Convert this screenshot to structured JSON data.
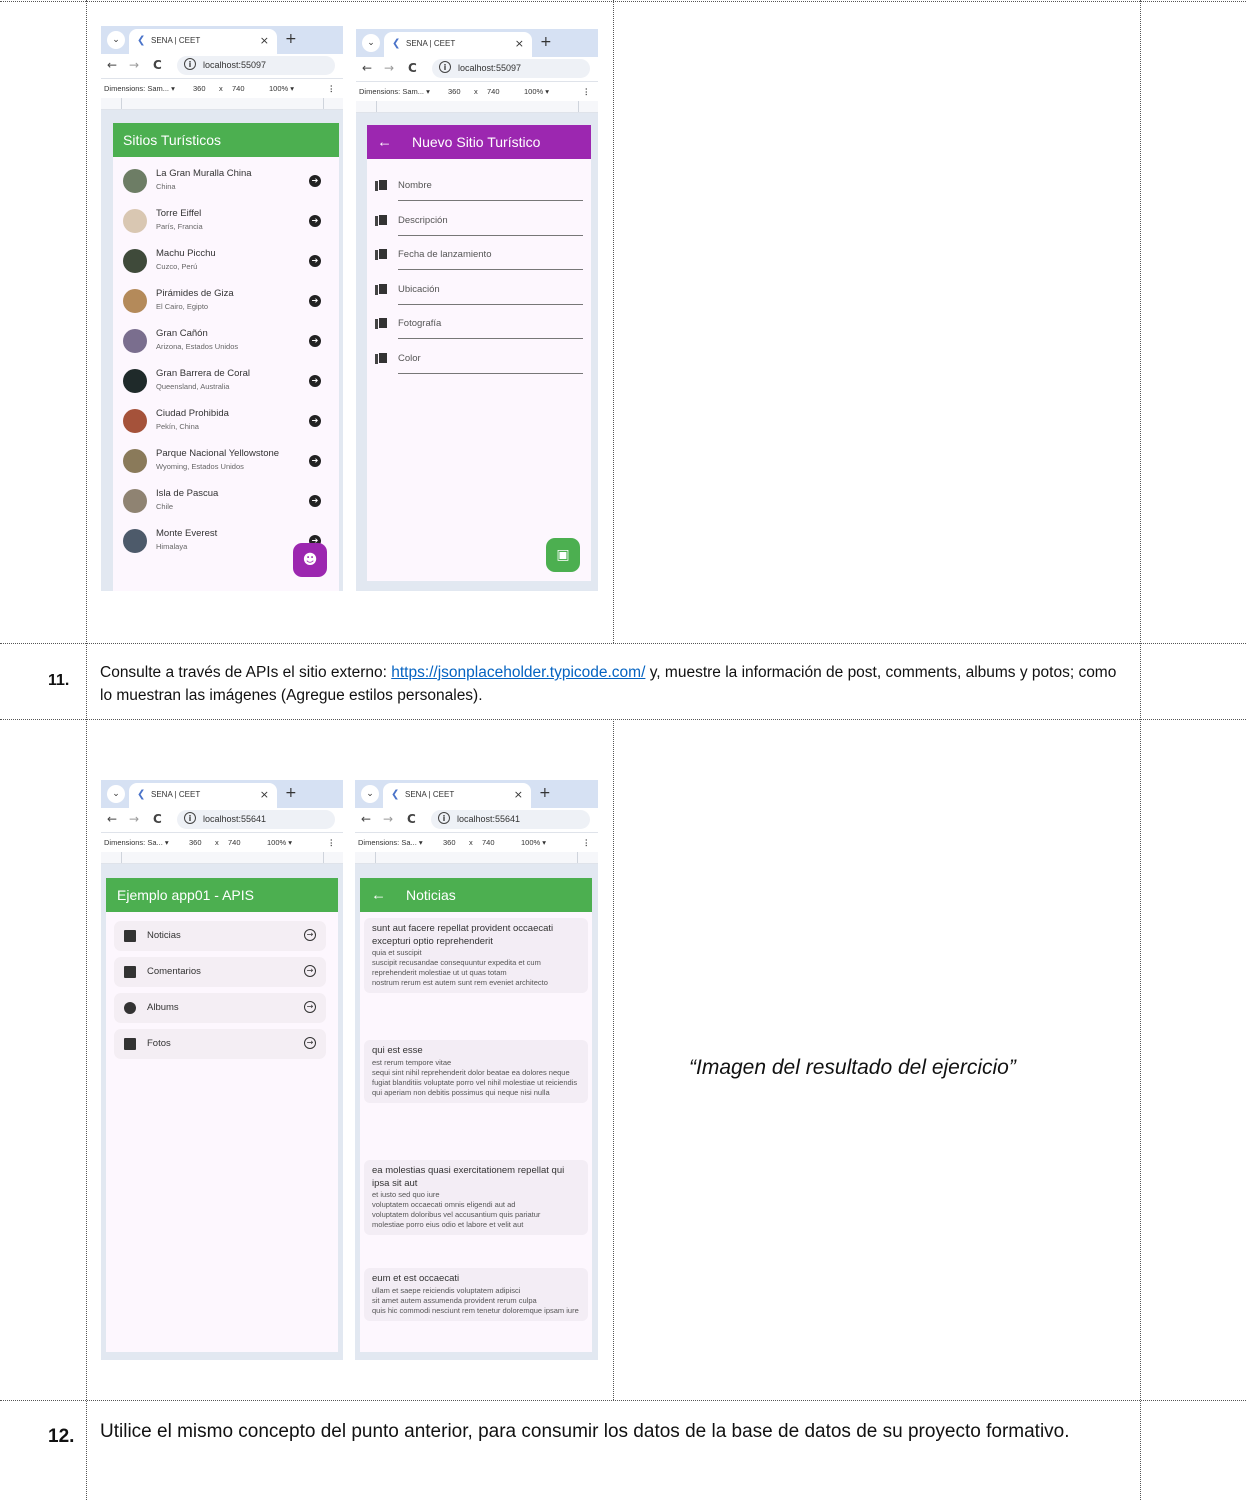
{
  "task11": {
    "number": "11.",
    "text_before": "Consulte a través de APIs el sitio externo: ",
    "link": "https://jsonplaceholder.typicode.com/",
    "text_after": " y, muestre la información de post, comments, albums y potos; como lo muestran las imágenes (Agregue estilos personales)."
  },
  "caption": "“Imagen del resultado del ejercicio”",
  "task12": {
    "number": "12.",
    "text": "Utilice el mismo concepto del punto anterior, para consumir los datos de la base de datos de su proyecto formativo."
  },
  "browser": {
    "tab_title": "SENA | CEET",
    "tab_close": "×",
    "tab_new": "+",
    "tab_dropdown": "⌄",
    "back": "←",
    "forward": "→",
    "reload": "C",
    "info": "i",
    "zoom": "100% ▾",
    "times": "x",
    "width": "360",
    "height": "740",
    "more": "⋮"
  },
  "shot1": {
    "url": "localhost:55097",
    "dimensions": "Dimensions: Sam... ▾",
    "appbar_title": "Sitios Turísticos",
    "accent": "#4caf50",
    "items": [
      {
        "name": "La Gran Muralla China",
        "sub": "China",
        "color": "#6d7d65"
      },
      {
        "name": "Torre Eiffel",
        "sub": "París, Francia",
        "color": "#d9c7b2"
      },
      {
        "name": "Machu Picchu",
        "sub": "Cuzco, Perú",
        "color": "#3f4a3a"
      },
      {
        "name": "Pirámides de Giza",
        "sub": "El Cairo, Egipto",
        "color": "#b48a5a"
      },
      {
        "name": "Gran Cañón",
        "sub": "Arizona, Estados Unidos",
        "color": "#7a6e8e"
      },
      {
        "name": "Gran Barrera de Coral",
        "sub": "Queensland, Australia",
        "color": "#1f2a2a"
      },
      {
        "name": "Ciudad Prohibida",
        "sub": "Pekín, China",
        "color": "#a5523a"
      },
      {
        "name": "Parque Nacional Yellowstone",
        "sub": "Wyoming, Estados Unidos",
        "color": "#8a7a5a"
      },
      {
        "name": "Isla de Pascua",
        "sub": "Chile",
        "color": "#8f8372"
      },
      {
        "name": "Monte Everest",
        "sub": "Himalaya",
        "color": "#4d5a6a"
      }
    ],
    "fab_color": "#9c27b0",
    "fab_icon": "☻"
  },
  "shot2": {
    "url": "localhost:55097",
    "dimensions": "Dimensions: Sam... ▾",
    "appbar_title": "Nuevo Sitio Turístico",
    "accent": "#9c27b0",
    "fields": [
      "Nombre",
      "Descripción",
      "Fecha de lanzamiento",
      "Ubicación",
      "Fotografía",
      "Color"
    ],
    "fab_color": "#4caf50",
    "fab_icon": "▣"
  },
  "shot3": {
    "url": "localhost:55641",
    "dimensions": "Dimensions: Sa... ▾",
    "appbar_title": "Ejemplo app01 - APIS",
    "accent": "#4caf50",
    "menu": [
      {
        "label": "Noticias",
        "icon": "newspaper-icon"
      },
      {
        "label": "Comentarios",
        "icon": "comment-icon"
      },
      {
        "label": "Albums",
        "icon": "album-icon"
      },
      {
        "label": "Fotos",
        "icon": "photo-icon"
      }
    ],
    "arrow": "→"
  },
  "shot4": {
    "url": "localhost:55641",
    "dimensions": "Dimensions: Sa... ▾",
    "appbar_title": "Noticias",
    "accent": "#4caf50",
    "posts": [
      {
        "title": "sunt aut facere repellat provident occaecati excepturi optio reprehenderit",
        "body": "quia et suscipit\nsuscipit recusandae consequuntur expedita et cum\nreprehenderit molestiae ut ut quas totam\nnostrum rerum est autem sunt rem eveniet architecto"
      },
      {
        "title": "qui est esse",
        "body": "est rerum tempore vitae\nsequi sint nihil reprehenderit dolor beatae ea dolores neque\nfugiat blanditiis voluptate porro vel nihil molestiae ut reiciendis\nqui aperiam non debitis possimus qui neque nisi nulla"
      },
      {
        "title": "ea molestias quasi exercitationem repellat qui ipsa sit aut",
        "body": "et iusto sed quo iure\nvoluptatem occaecati omnis eligendi aut ad\nvoluptatem doloribus vel accusantium quis pariatur\nmolestiae porro eius odio et labore et velit aut"
      },
      {
        "title": "eum et est occaecati",
        "body": "ullam et saepe reiciendis voluptatem adipisci\nsit amet autem assumenda provident rerum culpa\nquis hic commodi nesciunt rem tenetur doloremque ipsam iure"
      }
    ]
  }
}
